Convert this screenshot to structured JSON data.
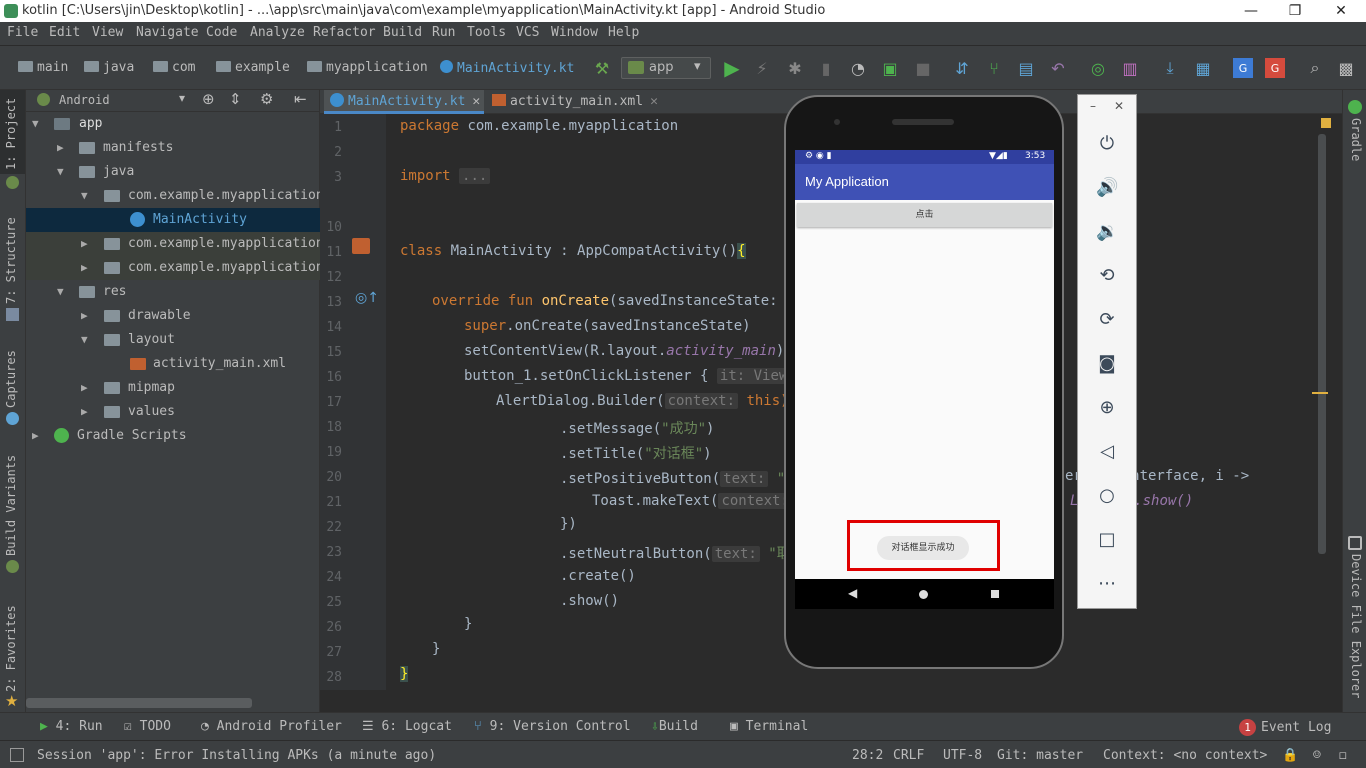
{
  "window": {
    "title": "kotlin [C:\\Users\\jin\\Desktop\\kotlin] - ...\\app\\src\\main\\java\\com\\example\\myapplication\\MainActivity.kt [app] - Android Studio",
    "minimize": "—",
    "maximize": "❐",
    "close": "✕"
  },
  "menu": [
    "File",
    "Edit",
    "View",
    "Navigate",
    "Code",
    "Analyze",
    "Refactor",
    "Build",
    "Run",
    "Tools",
    "VCS",
    "Window",
    "Help"
  ],
  "breadcrumbs": [
    "main",
    "java",
    "com",
    "example",
    "myapplication",
    "MainActivity.kt"
  ],
  "run_config": "app",
  "project": {
    "selector": "Android",
    "tree": [
      "app",
      "manifests",
      "java",
      "com.example.myapplication",
      "MainActivity",
      "com.example.myapplication (",
      "com.example.myapplication (",
      "res",
      "drawable",
      "layout",
      "activity_main.xml",
      "mipmap",
      "values",
      "Gradle Scripts"
    ]
  },
  "side_tabs_left": [
    "1: Project",
    "7: Structure",
    "Captures",
    "Build Variants",
    "2: Favorites"
  ],
  "side_tabs_right": [
    "Gradle",
    "Device File Explorer"
  ],
  "editor_tabs": [
    "MainActivity.kt",
    "activity_main.xml"
  ],
  "line_numbers": [
    "1",
    "2",
    "3",
    "10",
    "11",
    "12",
    "13",
    "14",
    "15",
    "16",
    "17",
    "18",
    "19",
    "20",
    "21",
    "22",
    "23",
    "24",
    "25",
    "26",
    "27",
    "28"
  ],
  "code": {
    "l1a": "package ",
    "l1b": "com.example.myapplication",
    "l3a": "import ",
    "l3b": "...",
    "l11a": "class ",
    "l11b": "MainActivity : AppCompatActivity()",
    "l11c": "{",
    "l13a": "override fun ",
    "l13b": "onCreate",
    "l13c": "(savedInstanceState: Bu",
    "l14a": "super",
    "l14b": ".onCreate(savedInstanceState)",
    "l15a": "setContentView(R.layout.",
    "l15b": "activity_main",
    "l15c": ")",
    "l16a": "button_1.setOnClickListener ",
    "l16b": "{",
    "l16c": "it: View!",
    "l17a": "AlertDialog.Builder(",
    "l17b": "context:",
    "l17c": " this)",
    "l18a": ".setMessage(",
    "l18b": "\"成功\"",
    "l18c": ")",
    "l19a": ".setTitle(",
    "l19b": "\"对话框\"",
    "l19c": ")",
    "l20a": ".setPositiveButton(",
    "l20b": "text:",
    "l20c": " \"确",
    "l20d": "er",
    "l20e": "ogInterface, i ->",
    "l21a": "Toast.makeText(",
    "l21b": "context:",
    "l21c": "L",
    "l21d": "ONG).show()",
    "l22": "})",
    "l23a": ".setNeutralButton(",
    "l23b": "text:",
    "l23c": " \"取",
    "l24": ".create()",
    "l25": ".show()",
    "l26": "}",
    "l27": "}",
    "l28": "}"
  },
  "bottom_tabs": [
    "4: Run",
    "TODO",
    "Android Profiler",
    "6: Logcat",
    "9: Version Control",
    "Build",
    "Terminal",
    "Event Log"
  ],
  "event_log_count": "1",
  "status": {
    "message": "Session 'app': Error Installing APKs (a minute ago)",
    "position": "28:2",
    "line_sep": "CRLF",
    "encoding": "UTF-8",
    "vcs": "Git: master",
    "context": "Context: <no context>"
  },
  "emulator": {
    "time": "3:53",
    "app_title": "My Application",
    "button_label": "点击",
    "toast": "对话框显示成功",
    "colors": {
      "appbar": "#3f51b5",
      "statusbar": "#303f9f",
      "highlight": "#e00000"
    }
  }
}
